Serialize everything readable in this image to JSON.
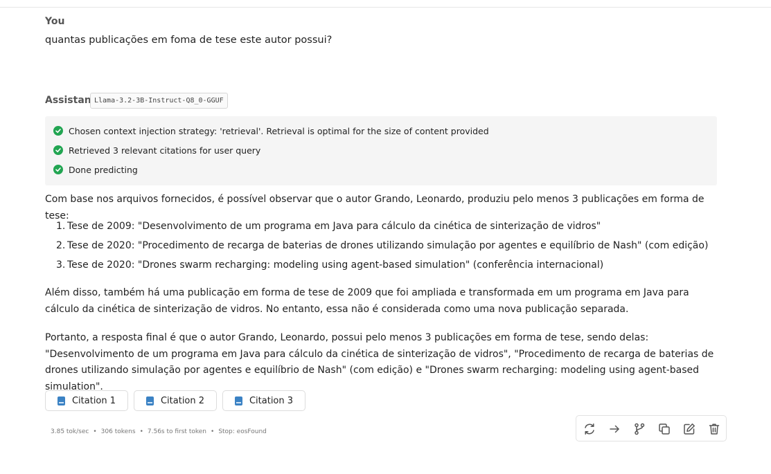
{
  "user": {
    "role_label": "You",
    "message": "quantas publicações em foma de tese este autor possui?"
  },
  "assistant": {
    "role_label": "Assistant",
    "model": "Llama-3.2-3B-Instruct-Q8_0-GGUF",
    "status_steps": [
      "Chosen context injection strategy: 'retrieval'. Retrieval is optimal for the size of content provided",
      "Retrieved 3 relevant citations for user query",
      "Done predicting"
    ],
    "intro": "Com base nos arquivos fornecidos, é possível observar que o autor Grando, Leonardo, produziu pelo menos 3 publicações em forma de tese:",
    "list": [
      {
        "num": "1.",
        "text": "Tese de 2009: \"Desenvolvimento de um programa em Java para cálculo da cinética de sinterização de vidros\""
      },
      {
        "num": "2.",
        "text": "Tese de 2020: \"Procedimento de recarga de baterias de drones utilizando simulação por agentes e equilíbrio de Nash\" (com edição)"
      },
      {
        "num": "3.",
        "text": "Tese de 2020: \"Drones swarm recharging: modeling using agent-based simulation\" (conferência internacional)"
      }
    ],
    "paragraph2": "Além disso, também há uma publicação em forma de tese de 2009 que foi ampliada e transformada em um programa em Java para cálculo da cinética de sinterização de vidros. No entanto, essa não é considerada como uma nova publicação separada.",
    "paragraph3": "Portanto, a resposta final é que o autor Grando, Leonardo, possui pelo menos 3 publicações em forma de tese, sendo delas: \"Desenvolvimento de um programa em Java para cálculo da cinética de sinterização de vidros\", \"Procedimento de recarga de baterias de drones utilizando simulação por agentes e equilíbrio de Nash\" (com edição) e \"Drones swarm recharging: modeling using agent-based simulation\".",
    "citations": [
      "Citation 1",
      "Citation 2",
      "Citation 3"
    ],
    "stats": {
      "speed": "3.85 tok/sec",
      "tokens": "306 tokens",
      "first_token": "7.56s to first token",
      "stop": "Stop: eosFound"
    }
  },
  "toolbar_icons": [
    "regenerate-icon",
    "continue-icon",
    "branch-icon",
    "copy-icon",
    "edit-icon",
    "delete-icon"
  ],
  "colors": {
    "check": "#22a552",
    "citation_icon": "#3b82c4",
    "status_bg": "#f5f5f5"
  }
}
